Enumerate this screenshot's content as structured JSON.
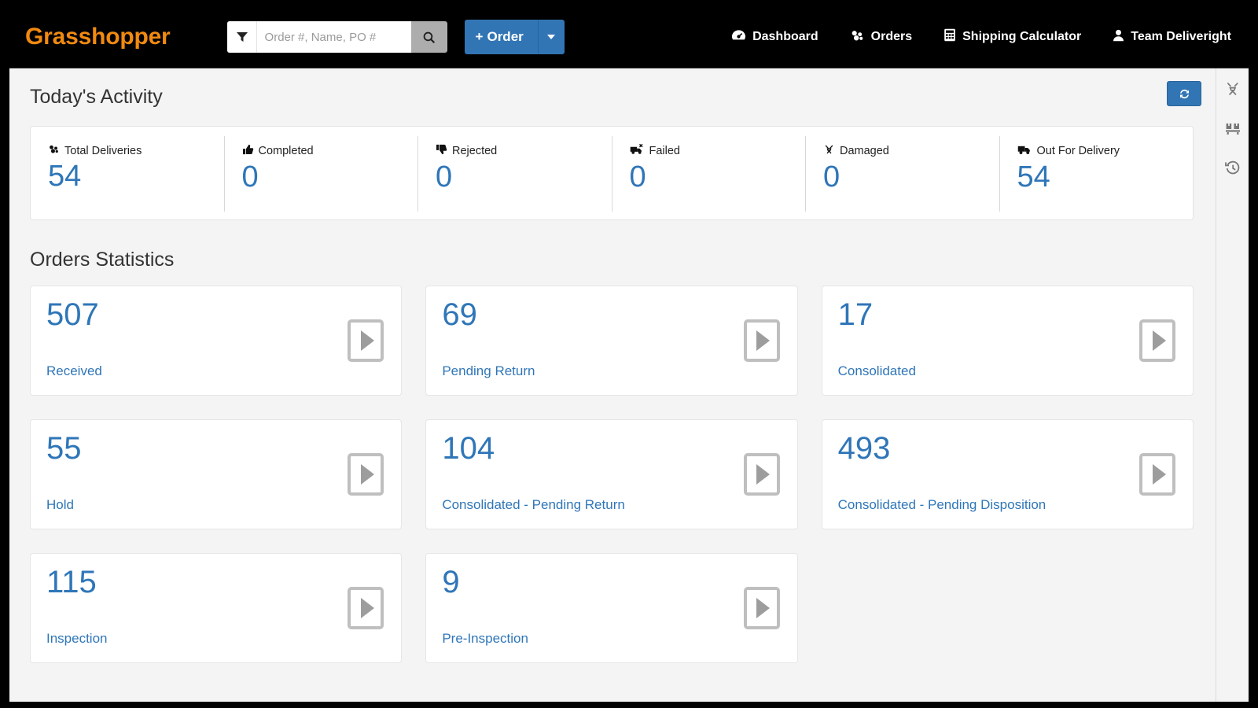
{
  "header": {
    "brand": "Grasshopper",
    "filter_icon": "filter-icon",
    "search": {
      "placeholder": "Order #, Name, PO #",
      "value": "",
      "search_icon": "search-icon"
    },
    "order_button": {
      "label": "Order",
      "plus": "+",
      "caret_icon": "chevron-down-icon"
    },
    "nav": [
      {
        "label": "Dashboard",
        "icon": "dashboard-gauge-icon"
      },
      {
        "label": "Orders",
        "icon": "orders-boxes-icon"
      },
      {
        "label": "Shipping Calculator",
        "icon": "calculator-icon"
      },
      {
        "label": "Team Deliveright",
        "icon": "user-icon"
      }
    ]
  },
  "toolbar": {
    "refresh_icon": "refresh-icon"
  },
  "rail": [
    {
      "icon": "unlink-icon",
      "name": "unlink"
    },
    {
      "icon": "pallet-boxes-icon",
      "name": "pallet"
    },
    {
      "icon": "history-clock-icon",
      "name": "history"
    }
  ],
  "activity": {
    "title": "Today's Activity",
    "items": [
      {
        "label": "Total Deliveries",
        "value": "54",
        "icon": "boxes-icon"
      },
      {
        "label": "Completed",
        "value": "0",
        "icon": "thumbs-up-icon"
      },
      {
        "label": "Rejected",
        "value": "0",
        "icon": "thumbs-down-icon"
      },
      {
        "label": "Failed",
        "value": "0",
        "icon": "truck-x-icon"
      },
      {
        "label": "Damaged",
        "value": "0",
        "icon": "damaged-icon"
      },
      {
        "label": "Out For Delivery",
        "value": "54",
        "icon": "truck-icon"
      }
    ]
  },
  "statistics": {
    "title": "Orders Statistics",
    "cards": [
      {
        "value": "507",
        "label": "Received"
      },
      {
        "value": "69",
        "label": "Pending Return"
      },
      {
        "value": "17",
        "label": "Consolidated"
      },
      {
        "value": "55",
        "label": "Hold"
      },
      {
        "value": "104",
        "label": "Consolidated - Pending Return"
      },
      {
        "value": "493",
        "label": "Consolidated - Pending Disposition"
      },
      {
        "value": "115",
        "label": "Inspection"
      },
      {
        "value": "9",
        "label": "Pre-Inspection"
      }
    ],
    "arrow_icon": "play-arrow-icon"
  },
  "colors": {
    "brand_orange": "#f08a11",
    "primary_blue": "#2f76b8",
    "header_black": "#000000",
    "page_bg": "#f4f4f4"
  }
}
